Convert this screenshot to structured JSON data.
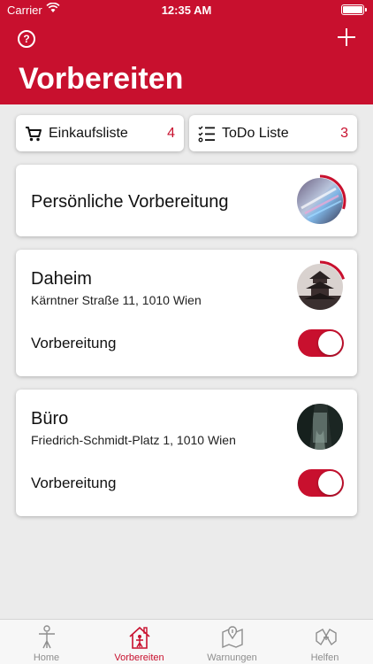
{
  "status_bar": {
    "carrier": "Carrier",
    "time": "12:35 AM"
  },
  "header": {
    "title": "Vorbereiten",
    "help_icon": "help-icon",
    "add_icon": "plus-icon"
  },
  "quick_lists": [
    {
      "label": "Einkaufsliste",
      "count": "4",
      "icon": "cart-icon"
    },
    {
      "label": "ToDo Liste",
      "count": "3",
      "icon": "checklist-icon"
    }
  ],
  "personal": {
    "title": "Persönliche Vorbereitung",
    "progress": 0.3
  },
  "locations": [
    {
      "name": "Daheim",
      "address": "Kärntner Straße 11, 1010 Wien",
      "toggle_label": "Vorbereitung",
      "toggle_on": true,
      "progress": 0.2
    },
    {
      "name": "Büro",
      "address": "Friedrich-Schmidt-Platz 1, 1010 Wien",
      "toggle_label": "Vorbereitung",
      "toggle_on": true,
      "progress": 0
    }
  ],
  "tabs": [
    {
      "label": "Home",
      "icon": "home-person-icon",
      "active": false
    },
    {
      "label": "Vorbereiten",
      "icon": "house-prepare-icon",
      "active": true
    },
    {
      "label": "Warnungen",
      "icon": "warning-map-icon",
      "active": false
    },
    {
      "label": "Helfen",
      "icon": "helping-hands-icon",
      "active": false
    }
  ],
  "colors": {
    "accent": "#c8102e",
    "background": "#ebebeb",
    "tab_inactive": "#8e8e8e"
  }
}
